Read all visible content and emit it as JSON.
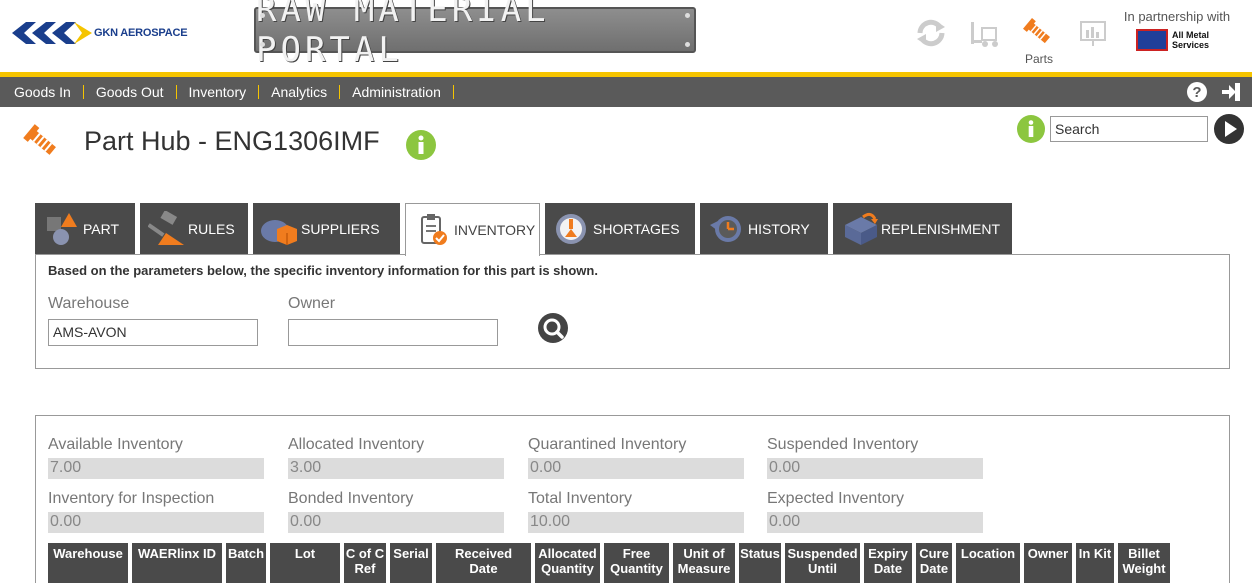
{
  "brand": {
    "company": "GKN AEROSPACE",
    "portal_title": "RAW MATERIAL PORTAL",
    "partner_text": "In partnership with",
    "partner_name_line1": "All Metal",
    "partner_name_line2": "Services"
  },
  "top_icons": [
    {
      "name": "refresh-icon",
      "label": ""
    },
    {
      "name": "forklift-icon",
      "label": ""
    },
    {
      "name": "parts-icon",
      "label": "Parts"
    },
    {
      "name": "analytics-board-icon",
      "label": ""
    }
  ],
  "nav": {
    "items": [
      "Goods In",
      "Goods Out",
      "Inventory",
      "Analytics",
      "Administration"
    ]
  },
  "page": {
    "title": "Part Hub - ENG1306IMF"
  },
  "search": {
    "placeholder": "Search"
  },
  "tabs": [
    {
      "label": "PART",
      "icon": "shapes-icon"
    },
    {
      "label": "RULES",
      "icon": "gavel-icon"
    },
    {
      "label": "SUPPLIERS",
      "icon": "supplier-box-icon"
    },
    {
      "label": "INVENTORY",
      "icon": "clipboard-check-icon",
      "active": true
    },
    {
      "label": "SHORTAGES",
      "icon": "shortage-gauge-icon"
    },
    {
      "label": "HISTORY",
      "icon": "history-clock-icon"
    },
    {
      "label": "REPLENISHMENT",
      "icon": "replenishment-icon"
    }
  ],
  "params": {
    "description": "Based on the parameters below, the specific inventory information for this part is shown.",
    "warehouse_label": "Warehouse",
    "warehouse_value": "AMS-AVON",
    "owner_label": "Owner",
    "owner_value": ""
  },
  "inventory": {
    "available_label": "Available Inventory",
    "available_value": "7.00",
    "allocated_label": "Allocated Inventory",
    "allocated_value": "3.00",
    "quarantined_label": "Quarantined Inventory",
    "quarantined_value": "0.00",
    "suspended_label": "Suspended Inventory",
    "suspended_value": "0.00",
    "inspection_label": "Inventory for Inspection",
    "inspection_value": "0.00",
    "bonded_label": "Bonded Inventory",
    "bonded_value": "0.00",
    "total_label": "Total Inventory",
    "total_value": "10.00",
    "expected_label": "Expected Inventory",
    "expected_value": "0.00"
  },
  "table": {
    "columns": [
      {
        "line1": "Warehouse",
        "line2": ""
      },
      {
        "line1": "WAERlinx ID",
        "line2": ""
      },
      {
        "line1": "Batch",
        "line2": ""
      },
      {
        "line1": "Lot",
        "line2": ""
      },
      {
        "line1": "C of C",
        "line2": "Ref"
      },
      {
        "line1": "Serial",
        "line2": ""
      },
      {
        "line1": "Received",
        "line2": "Date"
      },
      {
        "line1": "Allocated",
        "line2": "Quantity"
      },
      {
        "line1": "Free",
        "line2": "Quantity"
      },
      {
        "line1": "Unit of",
        "line2": "Measure"
      },
      {
        "line1": "Status",
        "line2": ""
      },
      {
        "line1": "Suspended",
        "line2": "Until"
      },
      {
        "line1": "Expiry",
        "line2": "Date"
      },
      {
        "line1": "Cure",
        "line2": "Date"
      },
      {
        "line1": "Location",
        "line2": ""
      },
      {
        "line1": "Owner",
        "line2": ""
      },
      {
        "line1": "In Kit",
        "line2": ""
      },
      {
        "line1": "Billet",
        "line2": "Weight"
      }
    ]
  },
  "colors": {
    "accent_yellow": "#f5c400",
    "nav_bg": "#5a5a5a",
    "tab_bg": "#4a4a4a",
    "info_green": "#8cc63f",
    "parts_orange": "#f07c1e",
    "gkn_blue": "#1a3e8c"
  }
}
